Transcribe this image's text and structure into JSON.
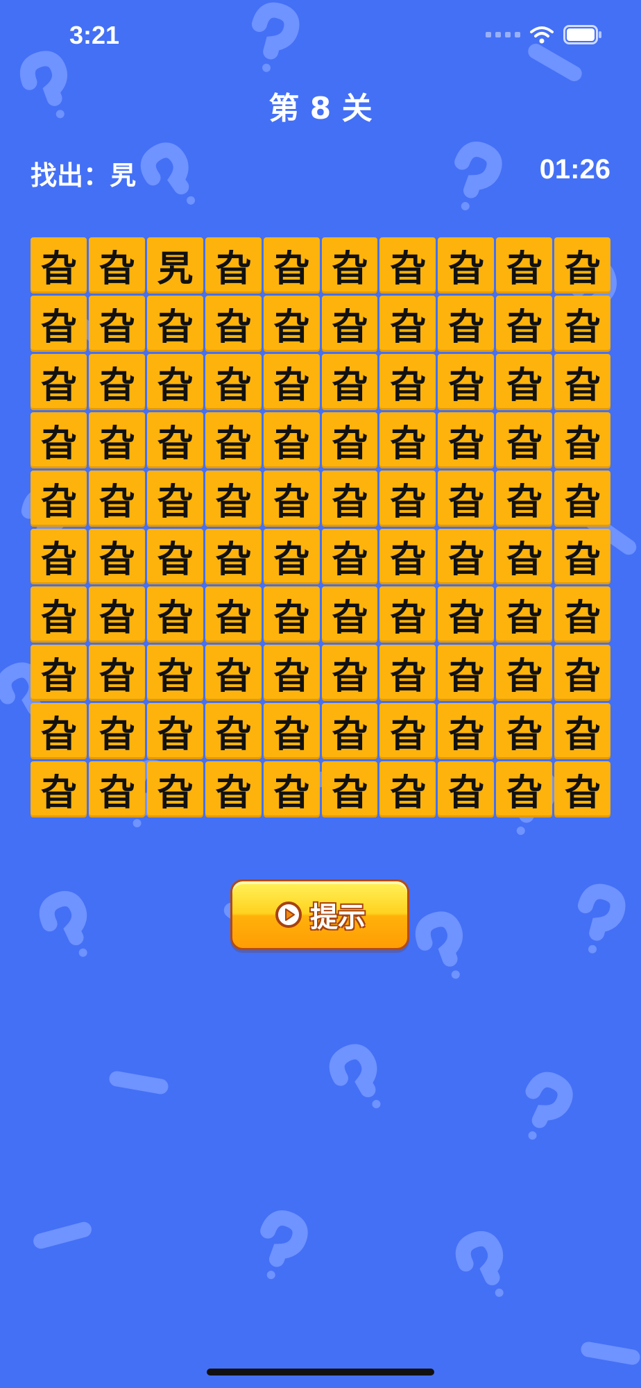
{
  "status_bar": {
    "time": "3:21",
    "icons": [
      "cellular-signal-icon",
      "wifi-icon",
      "battery-icon"
    ]
  },
  "game": {
    "title": "第 8 关",
    "target_label": "找出：",
    "target_char": "旯",
    "timer": "01:26",
    "grid": [
      [
        "旮",
        "旮",
        "旯",
        "旮",
        "旮",
        "旮",
        "旮",
        "旮",
        "旮",
        "旮"
      ],
      [
        "旮",
        "旮",
        "旮",
        "旮",
        "旮",
        "旮",
        "旮",
        "旮",
        "旮",
        "旮"
      ],
      [
        "旮",
        "旮",
        "旮",
        "旮",
        "旮",
        "旮",
        "旮",
        "旮",
        "旮",
        "旮"
      ],
      [
        "旮",
        "旮",
        "旮",
        "旮",
        "旮",
        "旮",
        "旮",
        "旮",
        "旮",
        "旮"
      ],
      [
        "旮",
        "旮",
        "旮",
        "旮",
        "旮",
        "旮",
        "旮",
        "旮",
        "旮",
        "旮"
      ],
      [
        "旮",
        "旮",
        "旮",
        "旮",
        "旮",
        "旮",
        "旮",
        "旮",
        "旮",
        "旮"
      ],
      [
        "旮",
        "旮",
        "旮",
        "旮",
        "旮",
        "旮",
        "旮",
        "旮",
        "旮",
        "旮"
      ],
      [
        "旮",
        "旮",
        "旮",
        "旮",
        "旮",
        "旮",
        "旮",
        "旮",
        "旮",
        "旮"
      ],
      [
        "旮",
        "旮",
        "旮",
        "旮",
        "旮",
        "旮",
        "旮",
        "旮",
        "旮",
        "旮"
      ],
      [
        "旮",
        "旮",
        "旮",
        "旮",
        "旮",
        "旮",
        "旮",
        "旮",
        "旮",
        "旮"
      ]
    ],
    "hint_button_label": "提示",
    "hint_icon": "play-circle-icon"
  },
  "colors": {
    "background": "#4470f5",
    "background_pattern": "#6f93ff",
    "tile": "#fdb30c",
    "tile_text": "#111111",
    "button_top": "#fff25a",
    "button_bottom": "#ff9d05",
    "button_border": "#b34a13"
  }
}
